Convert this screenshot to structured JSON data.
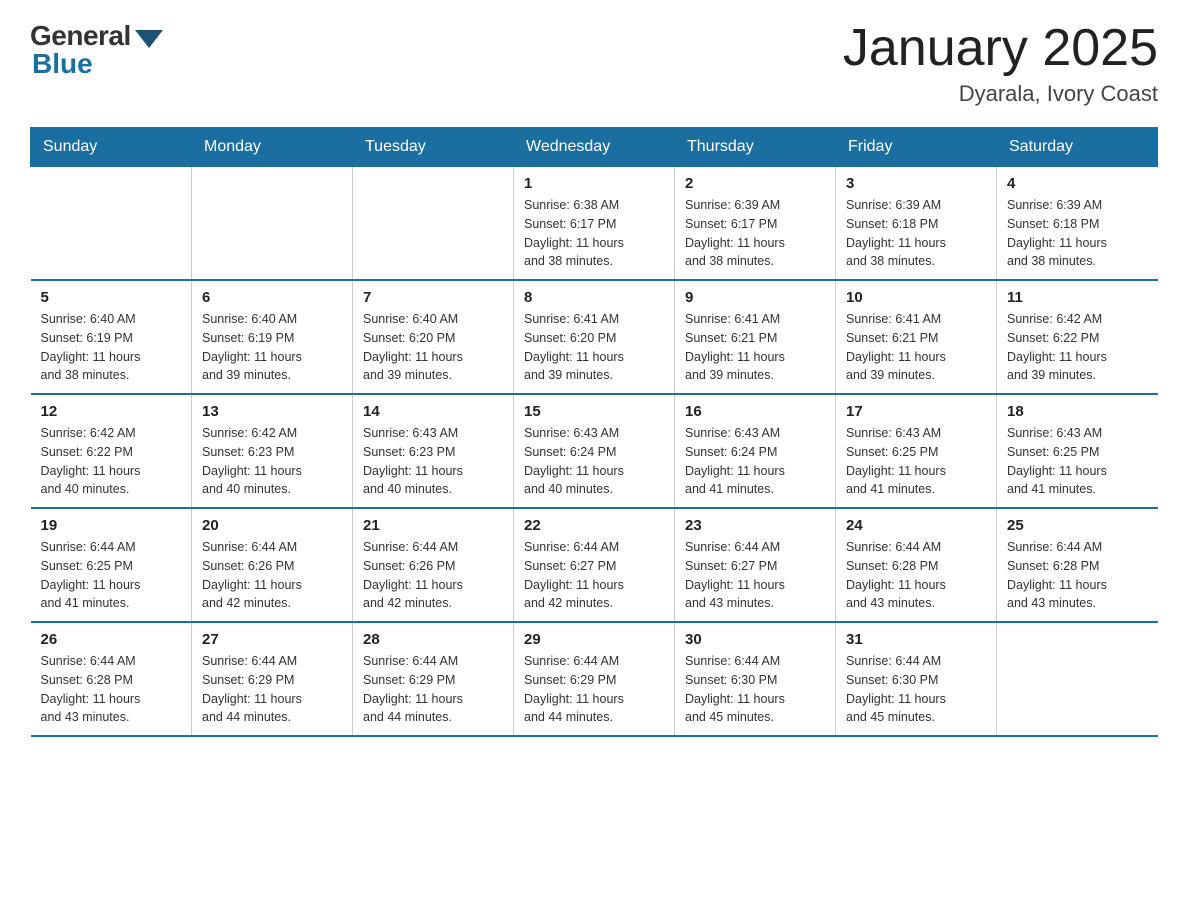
{
  "logo": {
    "general": "General",
    "blue": "Blue"
  },
  "title": "January 2025",
  "subtitle": "Dyarala, Ivory Coast",
  "days_header": [
    "Sunday",
    "Monday",
    "Tuesday",
    "Wednesday",
    "Thursday",
    "Friday",
    "Saturday"
  ],
  "weeks": [
    [
      {
        "day": "",
        "info": ""
      },
      {
        "day": "",
        "info": ""
      },
      {
        "day": "",
        "info": ""
      },
      {
        "day": "1",
        "info": "Sunrise: 6:38 AM\nSunset: 6:17 PM\nDaylight: 11 hours\nand 38 minutes."
      },
      {
        "day": "2",
        "info": "Sunrise: 6:39 AM\nSunset: 6:17 PM\nDaylight: 11 hours\nand 38 minutes."
      },
      {
        "day": "3",
        "info": "Sunrise: 6:39 AM\nSunset: 6:18 PM\nDaylight: 11 hours\nand 38 minutes."
      },
      {
        "day": "4",
        "info": "Sunrise: 6:39 AM\nSunset: 6:18 PM\nDaylight: 11 hours\nand 38 minutes."
      }
    ],
    [
      {
        "day": "5",
        "info": "Sunrise: 6:40 AM\nSunset: 6:19 PM\nDaylight: 11 hours\nand 38 minutes."
      },
      {
        "day": "6",
        "info": "Sunrise: 6:40 AM\nSunset: 6:19 PM\nDaylight: 11 hours\nand 39 minutes."
      },
      {
        "day": "7",
        "info": "Sunrise: 6:40 AM\nSunset: 6:20 PM\nDaylight: 11 hours\nand 39 minutes."
      },
      {
        "day": "8",
        "info": "Sunrise: 6:41 AM\nSunset: 6:20 PM\nDaylight: 11 hours\nand 39 minutes."
      },
      {
        "day": "9",
        "info": "Sunrise: 6:41 AM\nSunset: 6:21 PM\nDaylight: 11 hours\nand 39 minutes."
      },
      {
        "day": "10",
        "info": "Sunrise: 6:41 AM\nSunset: 6:21 PM\nDaylight: 11 hours\nand 39 minutes."
      },
      {
        "day": "11",
        "info": "Sunrise: 6:42 AM\nSunset: 6:22 PM\nDaylight: 11 hours\nand 39 minutes."
      }
    ],
    [
      {
        "day": "12",
        "info": "Sunrise: 6:42 AM\nSunset: 6:22 PM\nDaylight: 11 hours\nand 40 minutes."
      },
      {
        "day": "13",
        "info": "Sunrise: 6:42 AM\nSunset: 6:23 PM\nDaylight: 11 hours\nand 40 minutes."
      },
      {
        "day": "14",
        "info": "Sunrise: 6:43 AM\nSunset: 6:23 PM\nDaylight: 11 hours\nand 40 minutes."
      },
      {
        "day": "15",
        "info": "Sunrise: 6:43 AM\nSunset: 6:24 PM\nDaylight: 11 hours\nand 40 minutes."
      },
      {
        "day": "16",
        "info": "Sunrise: 6:43 AM\nSunset: 6:24 PM\nDaylight: 11 hours\nand 41 minutes."
      },
      {
        "day": "17",
        "info": "Sunrise: 6:43 AM\nSunset: 6:25 PM\nDaylight: 11 hours\nand 41 minutes."
      },
      {
        "day": "18",
        "info": "Sunrise: 6:43 AM\nSunset: 6:25 PM\nDaylight: 11 hours\nand 41 minutes."
      }
    ],
    [
      {
        "day": "19",
        "info": "Sunrise: 6:44 AM\nSunset: 6:25 PM\nDaylight: 11 hours\nand 41 minutes."
      },
      {
        "day": "20",
        "info": "Sunrise: 6:44 AM\nSunset: 6:26 PM\nDaylight: 11 hours\nand 42 minutes."
      },
      {
        "day": "21",
        "info": "Sunrise: 6:44 AM\nSunset: 6:26 PM\nDaylight: 11 hours\nand 42 minutes."
      },
      {
        "day": "22",
        "info": "Sunrise: 6:44 AM\nSunset: 6:27 PM\nDaylight: 11 hours\nand 42 minutes."
      },
      {
        "day": "23",
        "info": "Sunrise: 6:44 AM\nSunset: 6:27 PM\nDaylight: 11 hours\nand 43 minutes."
      },
      {
        "day": "24",
        "info": "Sunrise: 6:44 AM\nSunset: 6:28 PM\nDaylight: 11 hours\nand 43 minutes."
      },
      {
        "day": "25",
        "info": "Sunrise: 6:44 AM\nSunset: 6:28 PM\nDaylight: 11 hours\nand 43 minutes."
      }
    ],
    [
      {
        "day": "26",
        "info": "Sunrise: 6:44 AM\nSunset: 6:28 PM\nDaylight: 11 hours\nand 43 minutes."
      },
      {
        "day": "27",
        "info": "Sunrise: 6:44 AM\nSunset: 6:29 PM\nDaylight: 11 hours\nand 44 minutes."
      },
      {
        "day": "28",
        "info": "Sunrise: 6:44 AM\nSunset: 6:29 PM\nDaylight: 11 hours\nand 44 minutes."
      },
      {
        "day": "29",
        "info": "Sunrise: 6:44 AM\nSunset: 6:29 PM\nDaylight: 11 hours\nand 44 minutes."
      },
      {
        "day": "30",
        "info": "Sunrise: 6:44 AM\nSunset: 6:30 PM\nDaylight: 11 hours\nand 45 minutes."
      },
      {
        "day": "31",
        "info": "Sunrise: 6:44 AM\nSunset: 6:30 PM\nDaylight: 11 hours\nand 45 minutes."
      },
      {
        "day": "",
        "info": ""
      }
    ]
  ]
}
